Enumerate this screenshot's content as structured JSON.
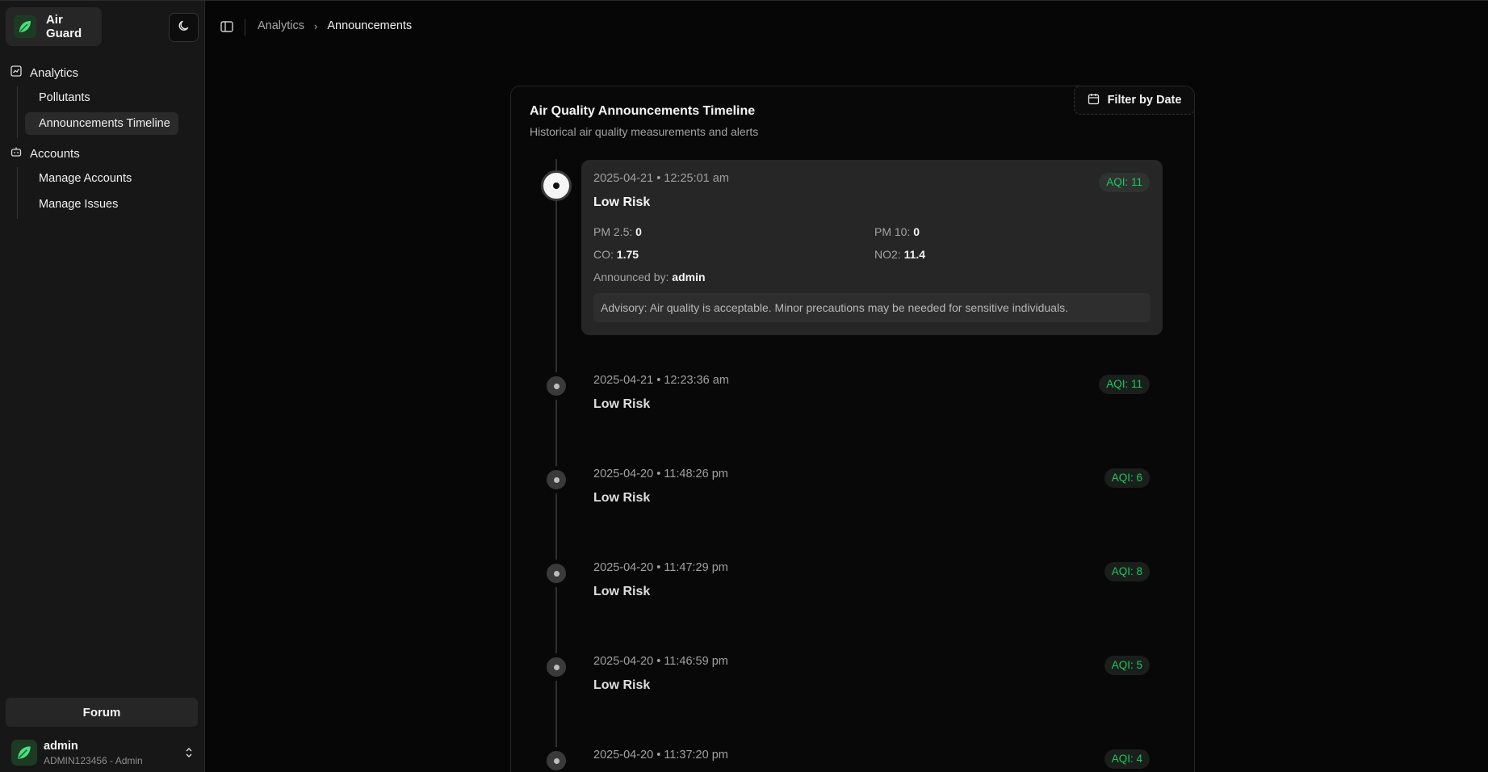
{
  "app": {
    "name": "Air Guard"
  },
  "sidebar": {
    "groups": [
      {
        "label": "Analytics",
        "icon": "chart-square-icon",
        "items": [
          {
            "label": "Pollutants",
            "active": false
          },
          {
            "label": "Announcements Timeline",
            "active": true
          }
        ]
      },
      {
        "label": "Accounts",
        "icon": "bot-icon",
        "items": [
          {
            "label": "Manage Accounts",
            "active": false
          },
          {
            "label": "Manage Issues",
            "active": false
          }
        ]
      }
    ],
    "forum_label": "Forum",
    "user": {
      "name": "admin",
      "subtitle": "ADMIN123456 - Admin"
    }
  },
  "header": {
    "breadcrumb": {
      "parent": "Analytics",
      "separator": "›",
      "current": "Announcements"
    }
  },
  "card": {
    "title": "Air Quality Announcements Timeline",
    "subtitle": "Historical air quality measurements and alerts",
    "filter_label": "Filter by Date",
    "entries": [
      {
        "timestamp": "2025-04-21 • 12:25:01 am",
        "risk": "Low Risk",
        "aqi": "AQI: 11",
        "pm25_label": "PM 2.5:",
        "pm25": "0",
        "pm10_label": "PM 10:",
        "pm10": "0",
        "co_label": "CO:",
        "co": "1.75",
        "no2_label": "NO2:",
        "no2": "11.4",
        "announced_label": "Announced by:",
        "announced_by": "admin",
        "advisory": "Advisory: Air quality is acceptable. Minor precautions may be needed for sensitive individuals."
      },
      {
        "timestamp": "2025-04-21 • 12:23:36 am",
        "risk": "Low Risk",
        "aqi": "AQI: 11"
      },
      {
        "timestamp": "2025-04-20 • 11:48:26 pm",
        "risk": "Low Risk",
        "aqi": "AQI: 6"
      },
      {
        "timestamp": "2025-04-20 • 11:47:29 pm",
        "risk": "Low Risk",
        "aqi": "AQI: 8"
      },
      {
        "timestamp": "2025-04-20 • 11:46:59 pm",
        "risk": "Low Risk",
        "aqi": "AQI: 5"
      },
      {
        "timestamp": "2025-04-20 • 11:37:20 pm",
        "risk": "",
        "aqi": "AQI: 4"
      }
    ]
  },
  "colors": {
    "accent_green": "#22c55e",
    "background": "#060606",
    "sidebar": "#171717"
  }
}
